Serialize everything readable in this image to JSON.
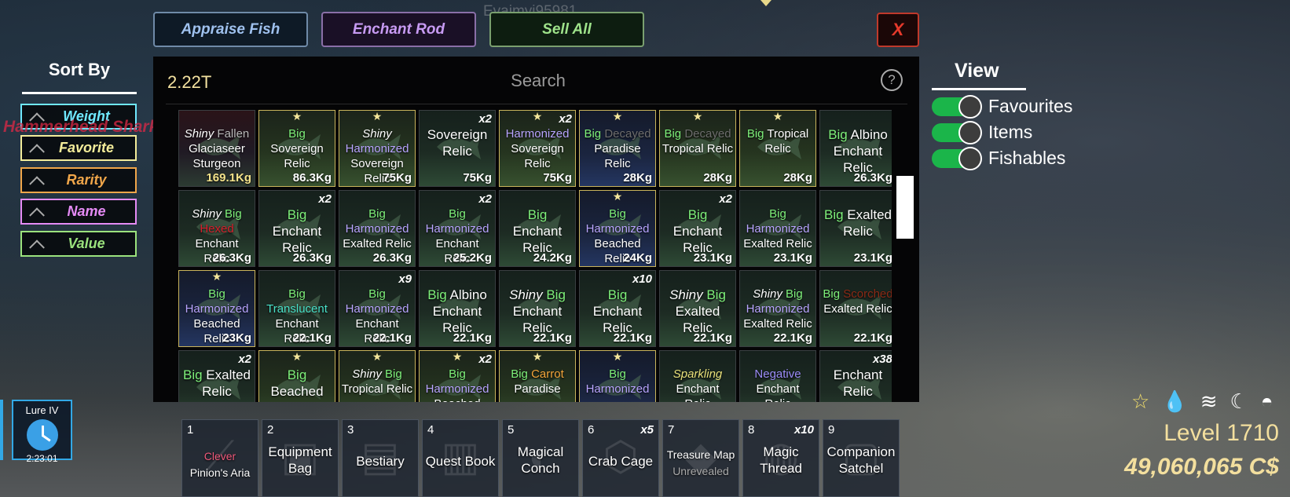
{
  "top_buttons": {
    "appraise": "Appraise Fish",
    "enchant": "Enchant Rod",
    "sell_all": "Sell All",
    "close": "X"
  },
  "username": "Evajmyj95981",
  "world_text": "Hammerhead Shark",
  "sort": {
    "title": "Sort By",
    "items": [
      {
        "label": "Weight",
        "color": "#6fe8ff"
      },
      {
        "label": "Favorite",
        "color": "#f3ec9a"
      },
      {
        "label": "Rarity",
        "color": "#f0a64a"
      },
      {
        "label": "Name",
        "color": "#e58bf5"
      },
      {
        "label": "Value",
        "color": "#9be27d"
      }
    ]
  },
  "inventory": {
    "money": "2.22T",
    "search_placeholder": "Search",
    "help": "?",
    "items": [
      {
        "lines": [
          [
            "Shiny ",
            "#fff",
            "i"
          ],
          [
            "Fallen",
            "#b8b8b8"
          ],
          [
            "\nGlaciaseer",
            "#fff"
          ],
          [
            "\nSturgeon",
            "#fff"
          ]
        ],
        "weight": "169.1Kg",
        "weight_color": "#f3e28a",
        "style": "red"
      },
      {
        "lines": [
          [
            "Big",
            "#7ef07a"
          ],
          [
            "\nSovereign",
            "#fff"
          ],
          [
            "\nRelic",
            "#fff"
          ]
        ],
        "weight": "86.3Kg",
        "fav": true
      },
      {
        "lines": [
          [
            "Shiny",
            "#fff",
            "i"
          ],
          [
            "\nHarmonized",
            "#b8a4ff"
          ],
          [
            "\nSovereign",
            "#fff"
          ],
          [
            "\nRelic",
            "#fff"
          ]
        ],
        "weight": "75Kg",
        "fav": true
      },
      {
        "lines": [
          [
            "Sovereign",
            "#fff"
          ],
          [
            "\nRelic",
            "#fff"
          ]
        ],
        "weight": "75Kg",
        "count": "x2",
        "big": true
      },
      {
        "lines": [
          [
            "Harmonized",
            "#b8a4ff"
          ],
          [
            "\nSovereign",
            "#fff"
          ],
          [
            "\nRelic",
            "#fff"
          ]
        ],
        "weight": "75Kg",
        "count": "x2",
        "fav": true
      },
      {
        "lines": [
          [
            "Big ",
            "#7ef07a"
          ],
          [
            "Decayed",
            "#6d6d6d"
          ],
          [
            "\nParadise",
            "#fff"
          ],
          [
            "\nRelic",
            "#fff"
          ]
        ],
        "weight": "28Kg",
        "fav": true,
        "style": "blue"
      },
      {
        "lines": [
          [
            "Big ",
            "#7ef07a"
          ],
          [
            "Decayed",
            "#6d6d6d"
          ],
          [
            "\nTropical Relic",
            "#fff"
          ]
        ],
        "weight": "28Kg",
        "fav": true
      },
      {
        "lines": [
          [
            "Big ",
            "#7ef07a"
          ],
          [
            "Tropical",
            "#fff"
          ],
          [
            "\nRelic",
            "#fff"
          ]
        ],
        "weight": "28Kg",
        "fav": true
      },
      {
        "lines": [
          [
            "Big ",
            "#7ef07a"
          ],
          [
            "Albino",
            "#fff"
          ],
          [
            "\nEnchant",
            "#fff"
          ],
          [
            "\nRelic",
            "#fff"
          ]
        ],
        "weight": "26.3Kg",
        "big": true
      },
      {
        "lines": [
          [
            "Shiny ",
            "#fff",
            "i"
          ],
          [
            "Big",
            "#7ef07a"
          ],
          [
            "\nHexed",
            "#d4202c"
          ],
          [
            "\nEnchant",
            "#fff"
          ],
          [
            "\nRelic",
            "#fff"
          ]
        ],
        "weight": "26.3Kg"
      },
      {
        "lines": [
          [
            "Big",
            "#7ef07a"
          ],
          [
            "\nEnchant",
            "#fff"
          ],
          [
            "\nRelic",
            "#fff"
          ]
        ],
        "weight": "26.3Kg",
        "count": "x2",
        "big": true
      },
      {
        "lines": [
          [
            "Big",
            "#7ef07a"
          ],
          [
            "\nHarmonized",
            "#b8a4ff"
          ],
          [
            "\nExalted Relic",
            "#fff"
          ]
        ],
        "weight": "26.3Kg"
      },
      {
        "lines": [
          [
            "Big",
            "#7ef07a"
          ],
          [
            "\nHarmonized",
            "#b8a4ff"
          ],
          [
            "\nEnchant Relic",
            "#fff"
          ]
        ],
        "weight": "25.2Kg",
        "count": "x2"
      },
      {
        "lines": [
          [
            "Big",
            "#7ef07a"
          ],
          [
            "\nEnchant",
            "#fff"
          ],
          [
            "\nRelic",
            "#fff"
          ]
        ],
        "weight": "24.2Kg",
        "big": true
      },
      {
        "lines": [
          [
            "Big",
            "#7ef07a"
          ],
          [
            "\nHarmonized",
            "#b8a4ff"
          ],
          [
            "\nBeached",
            "#fff"
          ],
          [
            "\nRelic",
            "#fff"
          ]
        ],
        "weight": "24Kg",
        "fav": true,
        "style": "blue"
      },
      {
        "lines": [
          [
            "Big",
            "#7ef07a"
          ],
          [
            "\nEnchant",
            "#fff"
          ],
          [
            "\nRelic",
            "#fff"
          ]
        ],
        "weight": "23.1Kg",
        "count": "x2",
        "big": true
      },
      {
        "lines": [
          [
            "Big",
            "#7ef07a"
          ],
          [
            "\nHarmonized",
            "#b8a4ff"
          ],
          [
            "\nExalted Relic",
            "#fff"
          ]
        ],
        "weight": "23.1Kg"
      },
      {
        "lines": [
          [
            "Big ",
            "#7ef07a"
          ],
          [
            "Exalted",
            "#fff"
          ],
          [
            "\nRelic",
            "#fff"
          ]
        ],
        "weight": "23.1Kg",
        "big": true
      },
      {
        "lines": [
          [
            "Big",
            "#7ef07a"
          ],
          [
            "\nHarmonized",
            "#b8a4ff"
          ],
          [
            "\nBeached",
            "#fff"
          ],
          [
            "\nRelic",
            "#fff"
          ]
        ],
        "weight": "23Kg",
        "fav": true,
        "style": "blue"
      },
      {
        "lines": [
          [
            "Big",
            "#7ef07a"
          ],
          [
            "\nTranslucent",
            "#49e0c8"
          ],
          [
            "\nEnchant Relic",
            "#fff"
          ]
        ],
        "weight": "22.1Kg"
      },
      {
        "lines": [
          [
            "Big",
            "#7ef07a"
          ],
          [
            "\nHarmonized",
            "#b8a4ff"
          ],
          [
            "\nEnchant Relic",
            "#fff"
          ]
        ],
        "weight": "22.1Kg",
        "count": "x9"
      },
      {
        "lines": [
          [
            "Big ",
            "#7ef07a"
          ],
          [
            "Albino",
            "#fff"
          ],
          [
            "\nEnchant",
            "#fff"
          ],
          [
            "\nRelic",
            "#fff"
          ]
        ],
        "weight": "22.1Kg",
        "big": true
      },
      {
        "lines": [
          [
            "Shiny ",
            "#fff",
            "i"
          ],
          [
            "Big",
            "#7ef07a"
          ],
          [
            "\nEnchant",
            "#fff"
          ],
          [
            "\nRelic",
            "#fff"
          ]
        ],
        "weight": "22.1Kg",
        "big": true
      },
      {
        "lines": [
          [
            "Big",
            "#7ef07a"
          ],
          [
            "\nEnchant",
            "#fff"
          ],
          [
            "\nRelic",
            "#fff"
          ]
        ],
        "weight": "22.1Kg",
        "count": "x10",
        "big": true
      },
      {
        "lines": [
          [
            "Shiny ",
            "#fff",
            "i"
          ],
          [
            "Big",
            "#7ef07a"
          ],
          [
            "\nExalted",
            "#fff"
          ],
          [
            "\nRelic",
            "#fff"
          ]
        ],
        "weight": "22.1Kg",
        "big": true
      },
      {
        "lines": [
          [
            "Shiny ",
            "#fff",
            "i"
          ],
          [
            "Big",
            "#7ef07a"
          ],
          [
            "\nHarmonized",
            "#b8a4ff"
          ],
          [
            "\nExalted Relic",
            "#fff"
          ]
        ],
        "weight": "22.1Kg"
      },
      {
        "lines": [
          [
            "Big ",
            "#7ef07a"
          ],
          [
            "Scorched",
            "#8a2a16"
          ],
          [
            "\nExalted Relic",
            "#fff"
          ]
        ],
        "weight": "22.1Kg"
      },
      {
        "lines": [
          [
            "Big ",
            "#7ef07a"
          ],
          [
            "Exalted",
            "#fff"
          ],
          [
            "\nRelic",
            "#fff"
          ]
        ],
        "weight": "",
        "count": "x2",
        "big": true
      },
      {
        "lines": [
          [
            "Big",
            "#7ef07a"
          ],
          [
            "\nBeached",
            "#fff"
          ]
        ],
        "weight": "",
        "fav": true,
        "big": true
      },
      {
        "lines": [
          [
            "Shiny ",
            "#fff",
            "i"
          ],
          [
            "Big",
            "#7ef07a"
          ],
          [
            "\nTropical Relic",
            "#fff"
          ]
        ],
        "weight": "",
        "fav": true
      },
      {
        "lines": [
          [
            "Big",
            "#7ef07a"
          ],
          [
            "\nHarmonized",
            "#b8a4ff"
          ],
          [
            "\nBeached",
            "#fff"
          ]
        ],
        "weight": "",
        "fav": true,
        "count": "x2"
      },
      {
        "lines": [
          [
            "Big ",
            "#7ef07a"
          ],
          [
            "Carrot",
            "#f2a43a"
          ],
          [
            "\nParadise",
            "#fff"
          ]
        ],
        "weight": "",
        "fav": true
      },
      {
        "lines": [
          [
            "Big",
            "#7ef07a"
          ],
          [
            "\nHarmonized",
            "#b8a4ff"
          ]
        ],
        "weight": "",
        "fav": true,
        "style": "blue"
      },
      {
        "lines": [
          [
            "Sparkling",
            "#e8e07a",
            "i"
          ],
          [
            "\nEnchant Relic",
            "#fff"
          ]
        ],
        "weight": ""
      },
      {
        "lines": [
          [
            "Negative",
            "#9b8cf7"
          ],
          [
            "\nEnchant Relic",
            "#fff"
          ]
        ],
        "weight": ""
      },
      {
        "lines": [
          [
            "Enchant",
            "#fff"
          ],
          [
            "\nRelic",
            "#fff"
          ]
        ],
        "weight": "",
        "count": "x38",
        "big": true
      }
    ]
  },
  "view": {
    "title": "View",
    "toggles": [
      {
        "label": "Favourites",
        "on": true
      },
      {
        "label": "Items",
        "on": true
      },
      {
        "label": "Fishables",
        "on": true
      }
    ]
  },
  "lure": {
    "name": "Lure IV",
    "time": "2:23:01"
  },
  "hotbar": [
    {
      "num": "1",
      "lines": [
        [
          "Clever",
          "#f0597a"
        ],
        [
          "\nPinion's Aria",
          "#fff"
        ]
      ],
      "icon": "rod-icon"
    },
    {
      "num": "2",
      "lines": [
        [
          "Equipment",
          "#fff"
        ],
        [
          "\nBag",
          "#fff"
        ]
      ],
      "icon": "bag-icon"
    },
    {
      "num": "3",
      "lines": [
        [
          "Bestiary",
          "#fff"
        ]
      ],
      "icon": "book-icon"
    },
    {
      "num": "4",
      "lines": [
        [
          "Quest Book",
          "#fff"
        ]
      ],
      "icon": "quest-book-icon"
    },
    {
      "num": "5",
      "lines": [
        [
          "Magical",
          "#fff"
        ],
        [
          "\nConch",
          "#fff"
        ]
      ],
      "icon": "conch-icon"
    },
    {
      "num": "6",
      "lines": [
        [
          "Crab Cage",
          "#fff"
        ]
      ],
      "icon": "cage-icon",
      "count": "x5"
    },
    {
      "num": "7",
      "lines": [
        [
          "Treasure Map",
          "#fff"
        ],
        [
          "\nUnrevealed",
          "#aaa"
        ]
      ],
      "icon": "map-icon",
      "small": true
    },
    {
      "num": "8",
      "lines": [
        [
          "Magic",
          "#fff"
        ],
        [
          "\nThread",
          "#fff"
        ]
      ],
      "icon": "thread-icon",
      "count": "x10"
    },
    {
      "num": "9",
      "lines": [
        [
          "Companion",
          "#fff"
        ],
        [
          "\nSatchel",
          "#fff"
        ]
      ],
      "icon": "satchel-icon"
    }
  ],
  "status": {
    "icons": [
      "star-icon",
      "water-drop-icon",
      "wind-icon",
      "moon-icon",
      "sunrise-icon"
    ],
    "level": "Level 1710",
    "cash": "49,060,065 C$"
  }
}
